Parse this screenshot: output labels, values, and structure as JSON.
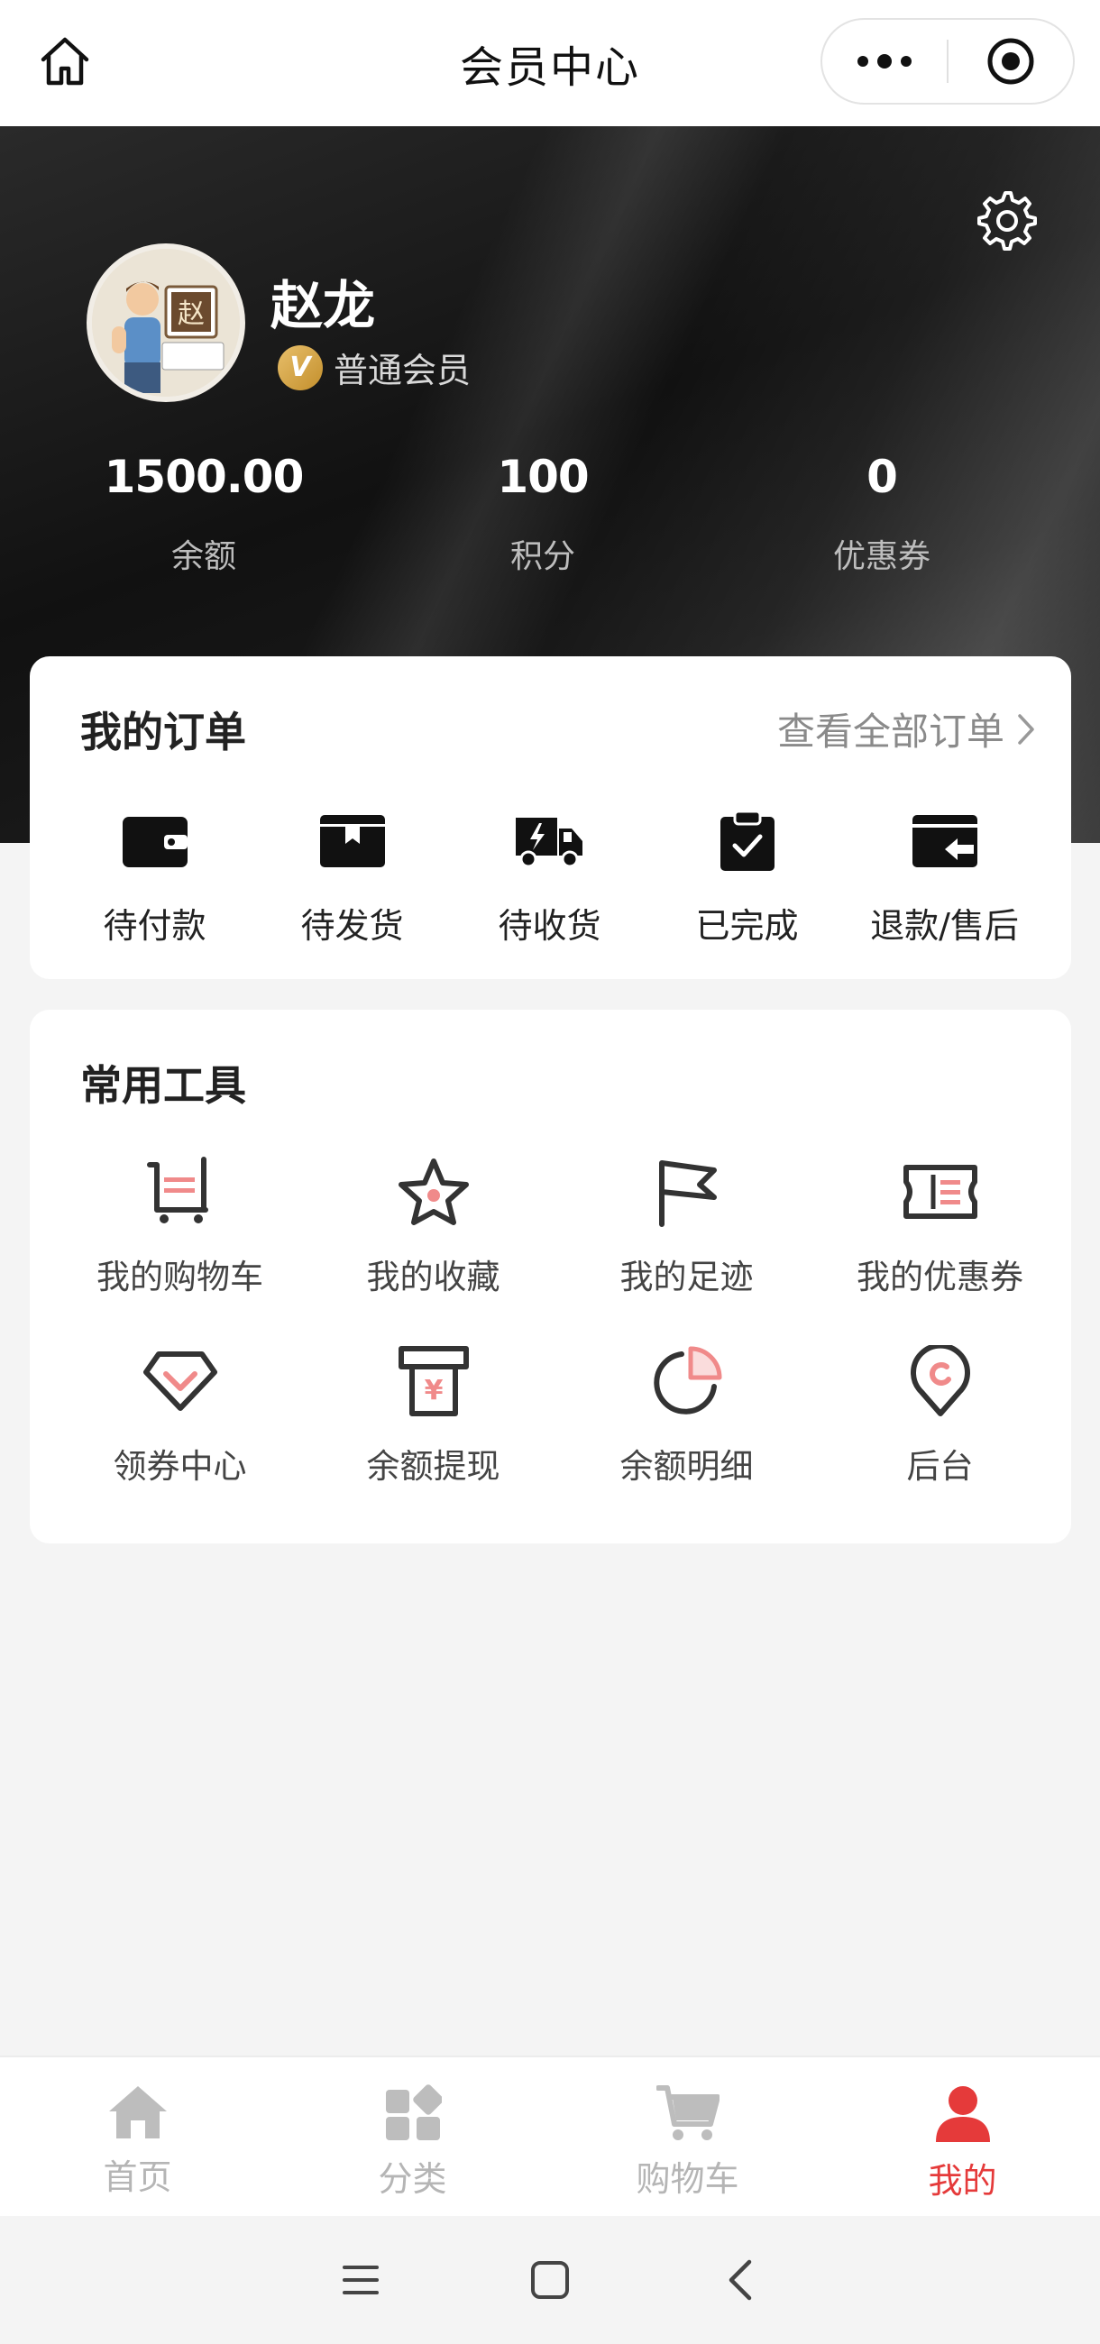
{
  "header": {
    "title": "会员中心"
  },
  "profile": {
    "name": "赵龙",
    "level": "普通会员",
    "badge_letter": "V",
    "avatar_char": "赵"
  },
  "stats": [
    {
      "value": "1500.00",
      "label": "余额"
    },
    {
      "value": "100",
      "label": "积分"
    },
    {
      "value": "0",
      "label": "优惠券"
    }
  ],
  "orders": {
    "title": "我的订单",
    "view_all": "查看全部订单",
    "items": [
      {
        "label": "待付款",
        "icon": "wallet-icon"
      },
      {
        "label": "待发货",
        "icon": "box-icon"
      },
      {
        "label": "待收货",
        "icon": "truck-icon"
      },
      {
        "label": "已完成",
        "icon": "clipboard-check-icon"
      },
      {
        "label": "退款/售后",
        "icon": "refund-icon"
      }
    ]
  },
  "tools": {
    "title": "常用工具",
    "items": [
      {
        "label": "我的购物车",
        "icon": "cart-icon"
      },
      {
        "label": "我的收藏",
        "icon": "star-icon"
      },
      {
        "label": "我的足迹",
        "icon": "flag-icon"
      },
      {
        "label": "我的优惠券",
        "icon": "ticket-icon"
      },
      {
        "label": "领券中心",
        "icon": "diamond-icon"
      },
      {
        "label": "余额提现",
        "icon": "atm-icon"
      },
      {
        "label": "余额明细",
        "icon": "pie-icon"
      },
      {
        "label": "后台",
        "icon": "location-icon"
      }
    ]
  },
  "tabbar": {
    "items": [
      {
        "label": "首页",
        "icon": "home-icon"
      },
      {
        "label": "分类",
        "icon": "category-icon"
      },
      {
        "label": "购物车",
        "icon": "cart-icon"
      },
      {
        "label": "我的",
        "icon": "user-icon",
        "active": true
      }
    ]
  },
  "colors": {
    "accent": "#e53a3a",
    "tool_accent": "#f08a8a",
    "icon_dark": "#333333",
    "badge_gold": "#d4a340"
  }
}
